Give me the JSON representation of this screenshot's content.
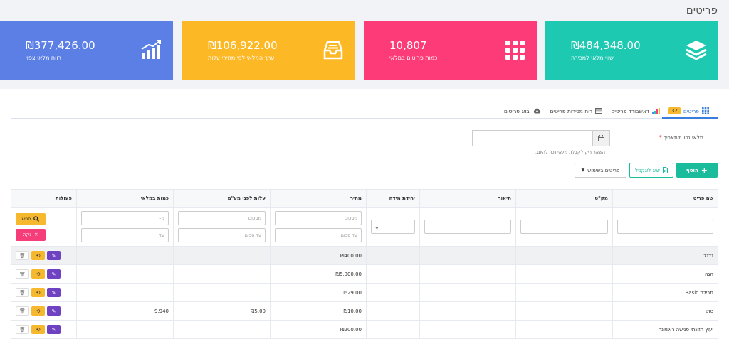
{
  "page": {
    "title": "פריטים"
  },
  "cards": [
    {
      "value": "₪484,348.00",
      "label": "שווי מלאי למכירה",
      "color": "#1ec9b1",
      "icon": "layers-icon"
    },
    {
      "value": "10,807",
      "label": "כמות פריטים במלאי",
      "color": "#fd3b78",
      "icon": "grid-icon"
    },
    {
      "value": "₪106,922.00",
      "label": "ערך המלאי לפי מחירי עלות",
      "color": "#fdb826",
      "icon": "inbox-icon"
    },
    {
      "value": "₪377,426.00",
      "label": "רווח מלאי צפוי",
      "color": "#5b7fe5",
      "icon": "bar-chart-icon"
    }
  ],
  "tabs": {
    "items": {
      "label": "פריטים",
      "badge": "32"
    },
    "dashboard": {
      "label": "דאשבורד פריטים"
    },
    "sales_report": {
      "label": "דוח מכירות פריטים"
    },
    "import": {
      "label": "יבוא פריטים"
    }
  },
  "filters": {
    "date_label": "מלאי נכון לתאריך",
    "required_mark": "*",
    "date_hint": "השאר ריק לקבלת מלאי נכון להיום."
  },
  "toolbar": {
    "add_label": "הוסף",
    "add_icon": "+",
    "excel_label": "יצא לאקסל",
    "used_items_label": "פריטים בשימוש"
  },
  "table": {
    "headers": [
      "שם פריט",
      "מק\"ט",
      "תיאור",
      "יחידת מידה",
      "מחיר",
      "עלות לפני מע\"מ",
      "כמות במלאי",
      "פעולות"
    ],
    "filter_placeholders": {
      "price_from": "מסכום",
      "price_to": "עד סכום",
      "cost_from": "מסכום",
      "cost_to": "עד סכום",
      "qty_from": "מ-",
      "qty_to": "עד"
    },
    "search_label": "חפש",
    "clear_label": "נקה",
    "rows": [
      {
        "name": "גלגל",
        "price": "₪400.00",
        "cost": "",
        "qty": ""
      },
      {
        "name": "הגה",
        "price": "₪5,000.00",
        "cost": "",
        "qty": ""
      },
      {
        "name": "חבילת Basic",
        "price": "₪29.00",
        "cost": "",
        "qty": ""
      },
      {
        "name": "טוש",
        "price": "₪10.00",
        "cost": "₪5.00",
        "qty": "9,940"
      },
      {
        "name": "יעוץ תזונתי פגישה ראשונה",
        "price": "₪200.00",
        "cost": "",
        "qty": ""
      }
    ]
  }
}
